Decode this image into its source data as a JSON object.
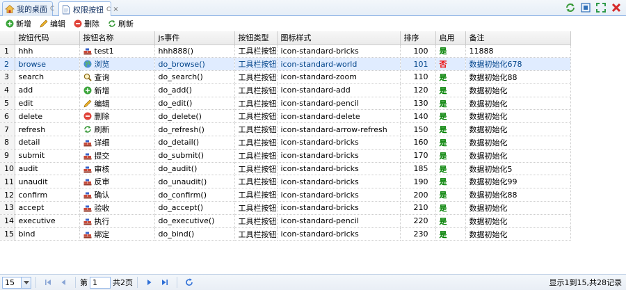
{
  "tabs": [
    {
      "label": "我的桌面",
      "refresh": "C",
      "active": false
    },
    {
      "label": "权限按钮",
      "refresh": "C",
      "close": "×",
      "active": true
    }
  ],
  "toolbar": {
    "add": "新增",
    "edit": "编辑",
    "delete": "删除",
    "refresh": "刷新"
  },
  "columns": [
    "按钮代码",
    "按钮名称",
    "js事件",
    "按钮类型",
    "图标样式",
    "排序",
    "启用",
    "备注"
  ],
  "rows": [
    {
      "n": "1",
      "code": "hhh",
      "name": "test1",
      "icon": "bricks",
      "event": "hhh888()",
      "type": "工具栏按钮",
      "style": "icon-standard-bricks",
      "order": "100",
      "enabled": "是",
      "remark": "11888"
    },
    {
      "n": "2",
      "code": "browse",
      "name": "浏览",
      "icon": "world",
      "event": "do_browse()",
      "type": "工具栏按钮",
      "style": "icon-standard-world",
      "order": "101",
      "enabled": "否",
      "remark": "数据初始化678"
    },
    {
      "n": "3",
      "code": "search",
      "name": "查询",
      "icon": "zoom",
      "event": "do_search()",
      "type": "工具栏按钮",
      "style": "icon-standard-zoom",
      "order": "110",
      "enabled": "是",
      "remark": "数据初始化88"
    },
    {
      "n": "4",
      "code": "add",
      "name": "新增",
      "icon": "add",
      "event": "do_add()",
      "type": "工具栏按钮",
      "style": "icon-standard-add",
      "order": "120",
      "enabled": "是",
      "remark": "数据初始化"
    },
    {
      "n": "5",
      "code": "edit",
      "name": "编辑",
      "icon": "pencil",
      "event": "do_edit()",
      "type": "工具栏按钮",
      "style": "icon-standard-pencil",
      "order": "130",
      "enabled": "是",
      "remark": "数据初始化"
    },
    {
      "n": "6",
      "code": "delete",
      "name": "删除",
      "icon": "delete",
      "event": "do_delete()",
      "type": "工具栏按钮",
      "style": "icon-standard-delete",
      "order": "140",
      "enabled": "是",
      "remark": "数据初始化"
    },
    {
      "n": "7",
      "code": "refresh",
      "name": "刷新",
      "icon": "refresh",
      "event": "do_refresh()",
      "type": "工具栏按钮",
      "style": "icon-standard-arrow-refresh",
      "order": "150",
      "enabled": "是",
      "remark": "数据初始化"
    },
    {
      "n": "8",
      "code": "detail",
      "name": "详细",
      "icon": "bricks",
      "event": "do_detail()",
      "type": "工具栏按钮",
      "style": "icon-standard-bricks",
      "order": "160",
      "enabled": "是",
      "remark": "数据初始化"
    },
    {
      "n": "9",
      "code": "submit",
      "name": "提交",
      "icon": "bricks",
      "event": "do_submit()",
      "type": "工具栏按钮",
      "style": "icon-standard-bricks",
      "order": "170",
      "enabled": "是",
      "remark": "数据初始化"
    },
    {
      "n": "10",
      "code": "audit",
      "name": "审核",
      "icon": "bricks",
      "event": "do_audit()",
      "type": "工具栏按钮",
      "style": "icon-standard-bricks",
      "order": "185",
      "enabled": "是",
      "remark": "数据初始化5"
    },
    {
      "n": "11",
      "code": "unaudit",
      "name": "反审",
      "icon": "bricks",
      "event": "do_unaudit()",
      "type": "工具栏按钮",
      "style": "icon-standard-bricks",
      "order": "190",
      "enabled": "是",
      "remark": "数据初始化99"
    },
    {
      "n": "12",
      "code": "confirm",
      "name": "确认",
      "icon": "bricks",
      "event": "do_confirm()",
      "type": "工具栏按钮",
      "style": "icon-standard-bricks",
      "order": "200",
      "enabled": "是",
      "remark": "数据初始化88"
    },
    {
      "n": "13",
      "code": "accept",
      "name": "验收",
      "icon": "bricks",
      "event": "do_accept()",
      "type": "工具栏按钮",
      "style": "icon-standard-bricks",
      "order": "210",
      "enabled": "是",
      "remark": "数据初始化"
    },
    {
      "n": "14",
      "code": "executive",
      "name": "执行",
      "icon": "bricks",
      "event": "do_executive()",
      "type": "工具栏按钮",
      "style": "icon-standard-pencil",
      "order": "220",
      "enabled": "是",
      "remark": "数据初始化"
    },
    {
      "n": "15",
      "code": "bind",
      "name": "绑定",
      "icon": "bricks",
      "event": "do_bind()",
      "type": "工具栏按钮",
      "style": "icon-standard-bricks",
      "order": "230",
      "enabled": "是",
      "remark": "数据初始化"
    }
  ],
  "selected_row": "2",
  "pager": {
    "page_size": "15",
    "page_label_before": "第",
    "page_value": "1",
    "page_label_after": "共2页",
    "info": "显示1到15,共28记录"
  },
  "colors": {
    "header_border": "#95b8e7",
    "selected_row": "#e0ecff",
    "enabled_yes": "#008000",
    "enabled_no": "#ee0000"
  }
}
